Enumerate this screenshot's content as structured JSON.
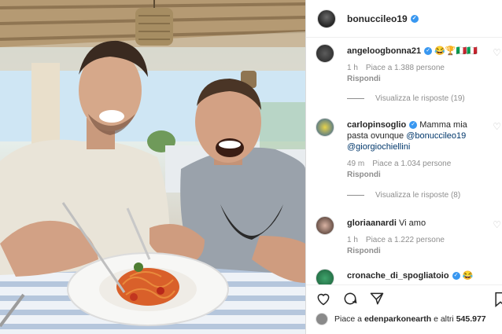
{
  "post": {
    "username": "bonuccileo19"
  },
  "comments": [
    {
      "username": "angeloogbonna21",
      "text": "😂🏆🇮🇹🇮🇹",
      "time": "1 h",
      "likes": "Piace a 1.388 persone",
      "reply_label": "Rispondi",
      "view_replies": "Visualizza le risposte (19)"
    },
    {
      "username": "carlopinsoglio",
      "text": "Mamma mia",
      "text2": "pasta ovunque",
      "mention1": "@bonuccileo19",
      "mention2": "@giorgiochiellini",
      "time": "49 m",
      "likes": "Piace a 1.034 persone",
      "reply_label": "Rispondi",
      "view_replies": "Visualizza le risposte (8)"
    },
    {
      "username": "gloriaanardi",
      "text": "Vi amo",
      "time": "1 h",
      "likes": "Piace a 1.222 persone",
      "reply_label": "Rispondi"
    },
    {
      "username": "cronache_di_spogliatoio",
      "text": "😂"
    }
  ],
  "liked_by": {
    "prefix": "Piace a",
    "user": "edenparkonearth",
    "suffix": "e altri",
    "count": "545.977"
  },
  "icons": [
    "heart-icon",
    "comment-icon",
    "share-icon",
    "bookmark-icon"
  ],
  "colors": {
    "verified": "#3897f0",
    "mention": "#00376b",
    "muted": "#8e8e8e"
  }
}
